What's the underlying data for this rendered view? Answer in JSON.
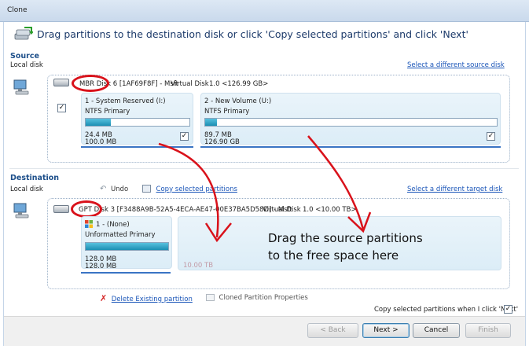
{
  "window": {
    "title": "Clone"
  },
  "header": {
    "instruction": "Drag partitions to the destination disk or click 'Copy selected partitions' and click 'Next'"
  },
  "source": {
    "section_title": "Source",
    "disk_type": "Local disk",
    "change_link": "Select a different source disk",
    "disk_name": "MBR Disk 6 [1AF69F8F] - Msft",
    "disk_model": "Virtual Disk",
    "disk_info": "1.0  <126.99 GB>",
    "checkbox_mark": "✓",
    "partitions": [
      {
        "name": "1 - System Reserved (I:)",
        "type": "NTFS Primary",
        "used": "24.4 MB",
        "total": "100.0 MB",
        "fill_fraction": 0.24,
        "check": "✓"
      },
      {
        "name": "2 - New Volume (U:)",
        "type": "NTFS Primary",
        "used": "89.7 MB",
        "total": "126.90 GB",
        "fill_fraction": 0.04,
        "check": "✓"
      }
    ]
  },
  "destination": {
    "section_title": "Destination",
    "disk_type": "Local disk",
    "undo_label": "Undo",
    "copy_link": "Copy selected partitions",
    "change_link": "Select a different target disk",
    "disk_name": "GPT Disk 3 [F3488A9B-52A5-4ECA-AE47-00E37BA5D58D] - Msft",
    "disk_model": "Virtual Disk",
    "disk_info": "1.0  <10.00 TB>",
    "partition": {
      "name": "1 -  (None)",
      "type": "Unformatted Primary",
      "used": "128.0 MB",
      "total": "128.0 MB",
      "fill_fraction": 1.0
    },
    "free_space_size": "10.00 TB",
    "overlay_line1": "Drag the source partitions",
    "overlay_line2": "to the free space here"
  },
  "actions": {
    "delete_label": "Delete Existing partition",
    "properties_label": "Cloned Partition Properties",
    "auto_copy_label": "Copy selected partitions when I click 'Next'",
    "auto_copy_mark": "✓"
  },
  "buttons": {
    "back": "< Back",
    "next": "Next >",
    "cancel": "Cancel",
    "finish": "Finish"
  },
  "colors": {
    "annotation_red": "#d9121b",
    "link_blue": "#1a55b8",
    "fill_cyan": "#1b8fb3"
  }
}
